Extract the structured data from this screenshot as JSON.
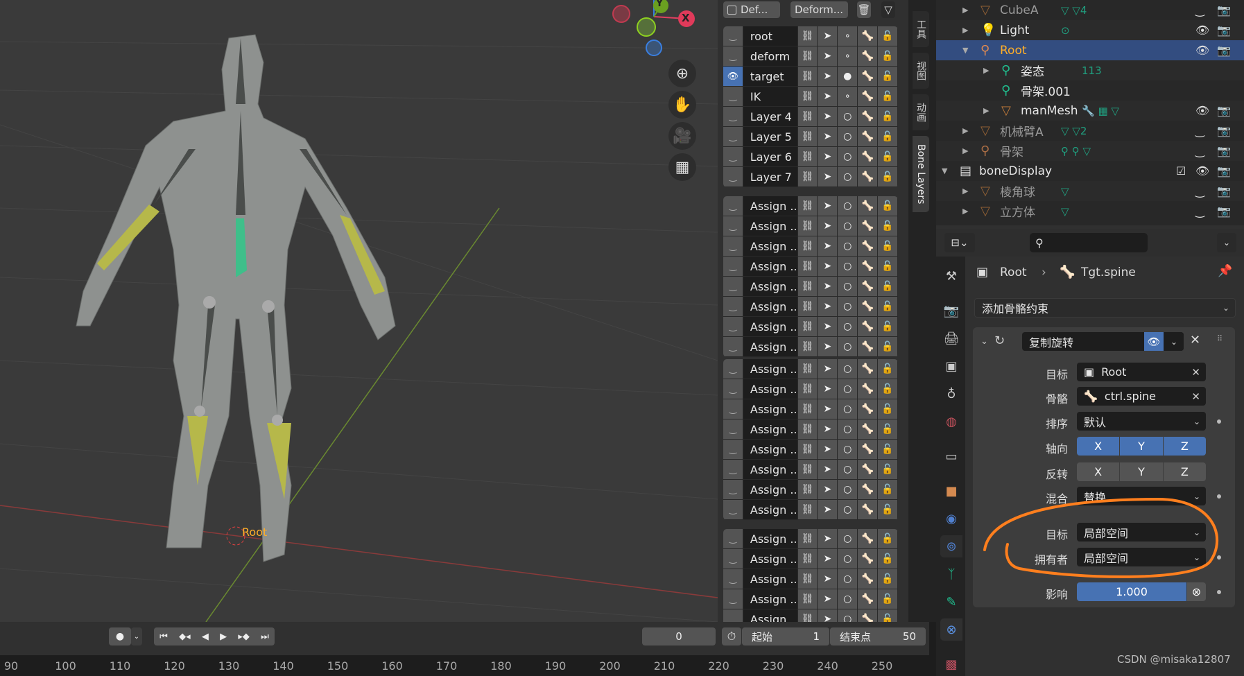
{
  "viewport": {
    "gizmo": {
      "x_label": "X",
      "y_label": "Y"
    },
    "nav_icons": [
      "zoom-icon",
      "hand-pan-icon",
      "camera-icon",
      "grid-view-icon"
    ],
    "object_label": "Root"
  },
  "bone_layers_panel": {
    "filter_checkbox_label": "Def...",
    "deform_button": "Deform...",
    "layers": [
      {
        "name": "root",
        "visible": false,
        "active_dot": "small"
      },
      {
        "name": "deform",
        "visible": false,
        "active_dot": "small"
      },
      {
        "name": "target",
        "visible": true,
        "active_dot": "filled"
      },
      {
        "name": "IK",
        "visible": false,
        "active_dot": "small"
      },
      {
        "name": "Layer 4",
        "visible": false,
        "active_dot": "ring"
      },
      {
        "name": "Layer 5",
        "visible": false,
        "active_dot": "ring"
      },
      {
        "name": "Layer 6",
        "visible": false,
        "active_dot": "ring"
      },
      {
        "name": "Layer 7",
        "visible": false,
        "active_dot": "ring"
      }
    ],
    "assign_label": "Assign ...",
    "assign_groups_rows": [
      8,
      8,
      5
    ]
  },
  "side_tabs": [
    "工具",
    "视图",
    "动画",
    "Bone Layers"
  ],
  "outliner": {
    "rows": [
      {
        "label": "CubeA",
        "icon": "mesh-object-icon",
        "extra": "▽ ▽4",
        "dim": true
      },
      {
        "label": "Light",
        "icon": "light-icon",
        "extra": "⊙",
        "dim": false
      },
      {
        "label": "Root",
        "icon": "armature-icon",
        "extra": "",
        "dim": false,
        "selected": true
      },
      {
        "label": "姿态",
        "icon": "pose-icon",
        "extra": "113",
        "dim": false
      },
      {
        "label": "骨架.001",
        "icon": "armature-data-icon",
        "extra": "",
        "dim": false
      },
      {
        "label": "manMesh",
        "icon": "mesh-object-icon",
        "extra": "🔧 ▦ ▽",
        "dim": false
      },
      {
        "label": "机械臂A",
        "icon": "mesh-object-icon",
        "extra": "▽ ▽2",
        "dim": true
      },
      {
        "label": "骨架",
        "icon": "armature-icon",
        "extra": "⚲ ⚲ ▽",
        "dim": true
      },
      {
        "label": "boneDisplay",
        "icon": "collection-icon",
        "extra": "",
        "dim": false
      },
      {
        "label": "棱角球",
        "icon": "mesh-object-icon",
        "extra": "▽",
        "dim": true
      },
      {
        "label": "立方体",
        "icon": "mesh-object-icon",
        "extra": "▽",
        "dim": true
      }
    ]
  },
  "properties": {
    "search_placeholder": "",
    "breadcrumb": {
      "object": "Root",
      "bone": "Tgt.spine"
    },
    "add_constraint": "添加骨骼约束",
    "constraint": {
      "name": "复制旋转",
      "target_label": "目标",
      "target_value": "Root",
      "bone_label": "骨骼",
      "bone_value": "ctrl.spine",
      "order_label": "排序",
      "order_value": "默认",
      "axis_label": "轴向",
      "axis": [
        "X",
        "Y",
        "Z"
      ],
      "invert_label": "反转",
      "invert": [
        "X",
        "Y",
        "Z"
      ],
      "mix_label": "混合",
      "mix_value": "替换",
      "target_space_label": "目标",
      "target_space_value": "局部空间",
      "owner_space_label": "拥有者",
      "owner_space_value": "局部空间",
      "influence_label": "影响",
      "influence_value": "1.000"
    },
    "watermark": "CSDN @misaka12807"
  },
  "timeline": {
    "current_frame": "0",
    "start_label": "起始",
    "start_value": "1",
    "end_label": "结束点",
    "end_value": "50",
    "ruler_ticks": [
      "90",
      "100",
      "110",
      "120",
      "130",
      "140",
      "150",
      "160",
      "170",
      "180",
      "190",
      "200",
      "210",
      "220",
      "230",
      "240",
      "250"
    ]
  },
  "colors": {
    "accent": "#4772b3",
    "selected_row": "#334d80",
    "root_text": "#ffaf29",
    "annotation": "#ff7f1e"
  }
}
